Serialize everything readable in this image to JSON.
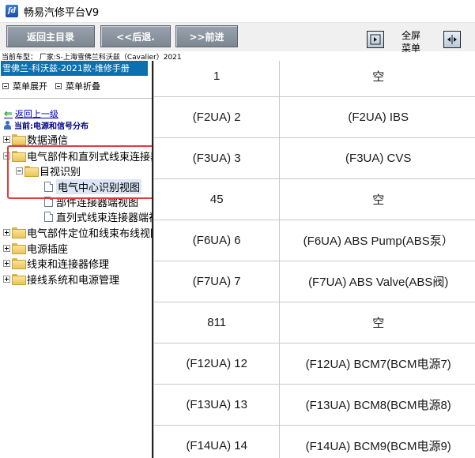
{
  "window": {
    "title": "畅易汽修平台V9"
  },
  "toolbar": {
    "back_main": "返回主目录",
    "prev": "<<后退.",
    "next": ">>前进",
    "fullscreen_menu": "全屏\n菜单"
  },
  "vehicle_line": "当前车型： 厂家:S-上海雪佛兰科沃兹（Cavalier）2021",
  "manual_header": "雪佛兰-科沃兹-2021款-维修手册",
  "menu_controls": {
    "expand": "菜单展开",
    "collapse": "菜单折叠"
  },
  "tree": {
    "back_link": "返回上一级",
    "current": "当前:电源和信号分布",
    "items": [
      {
        "label": "数据通信"
      },
      {
        "label": "电气部件和直列式线束连接器"
      },
      {
        "label": "目视识别"
      },
      {
        "label": "电气中心识别视图"
      },
      {
        "label": "部件连接器端视图"
      },
      {
        "label": "直列式线束连接器端视图"
      },
      {
        "label": "电气部件定位和线束布线视图"
      },
      {
        "label": "电源插座"
      },
      {
        "label": "线束和连接器修理"
      },
      {
        "label": "接线系统和电源管理"
      }
    ]
  },
  "fuse_table": {
    "rows": [
      {
        "id": "1",
        "desc": "空"
      },
      {
        "id": "(F2UA) 2",
        "desc": "(F2UA) IBS"
      },
      {
        "id": "(F3UA) 3",
        "desc": "(F3UA) CVS"
      },
      {
        "id": "45",
        "desc": "空"
      },
      {
        "id": "(F6UA) 6",
        "desc": "(F6UA) ABS Pump(ABS泵）"
      },
      {
        "id": "(F7UA) 7",
        "desc": "(F7UA) ABS Valve(ABS阀)"
      },
      {
        "id": "811",
        "desc": "空"
      },
      {
        "id": "(F12UA) 12",
        "desc": "(F12UA) BCM7(BCM电源7)"
      },
      {
        "id": "(F13UA) 13",
        "desc": "(F13UA) BCM8(BCM电源8)"
      },
      {
        "id": "(F14UA) 14",
        "desc": "(F14UA) BCM9(BCM电源9)"
      }
    ]
  },
  "colors": {
    "header_blue": "#0a70b0",
    "highlight_red": "#e23b3b",
    "toolbar_button": "#8a939c",
    "link_blue": "#0000cc"
  }
}
